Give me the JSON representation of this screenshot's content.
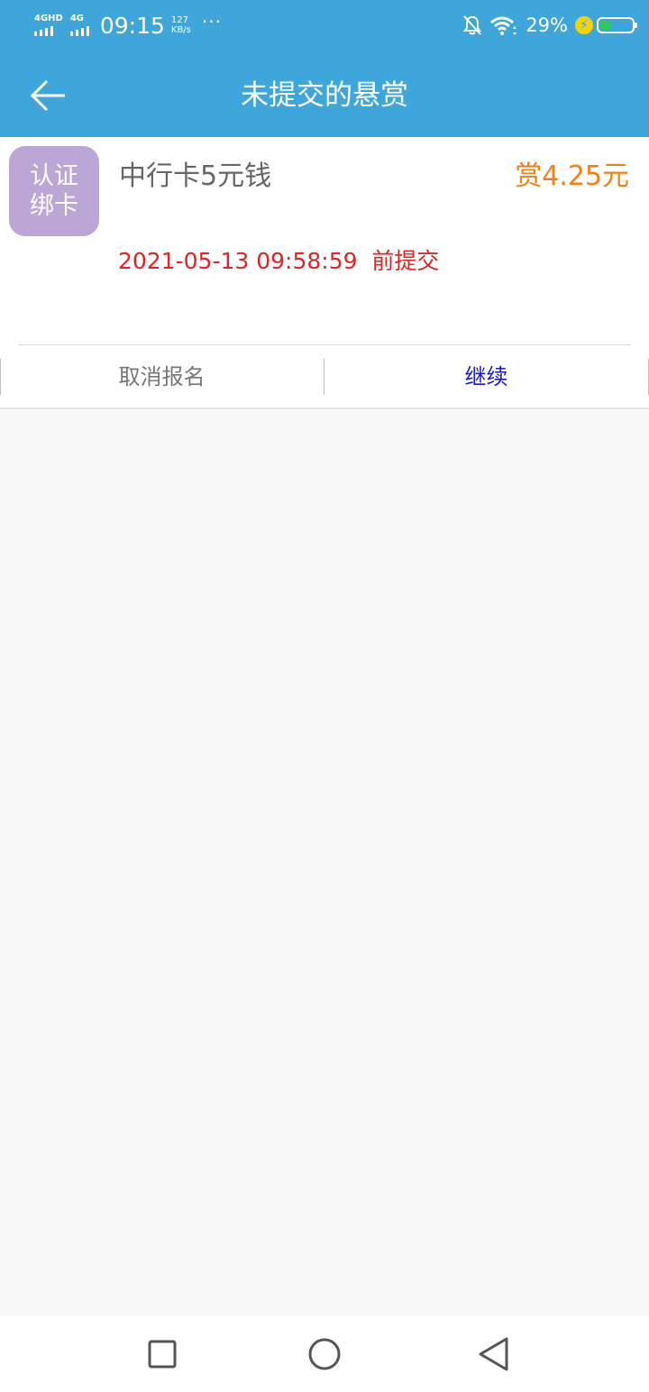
{
  "status_bar": {
    "network_1": "4GHD",
    "network_2": "4G",
    "time": "09:15",
    "speed_value": "127",
    "speed_unit": "KB/s",
    "more": "···",
    "battery_percent": "29%",
    "battery_level": 0.29,
    "battery_color": "#2ecc55"
  },
  "app_bar": {
    "title": "未提交的悬赏",
    "background": "#3ea6db"
  },
  "task": {
    "badge_line1": "认证",
    "badge_line2": "绑卡",
    "title": "中行卡5元钱",
    "reward": "赏4.25元",
    "deadline": "2021-05-13 09:58:59  前提交",
    "cancel_label": "取消报名",
    "continue_label": "继续",
    "reward_color": "#f57f17",
    "deadline_color": "#e02424"
  },
  "nav_bar": {
    "icons": [
      "recent-apps-icon",
      "home-icon",
      "back-icon"
    ]
  }
}
